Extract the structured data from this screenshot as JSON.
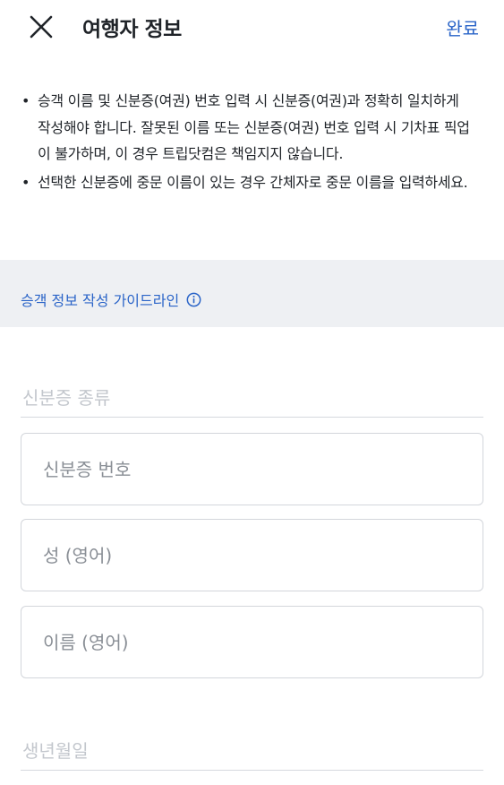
{
  "header": {
    "title": "여행자 정보",
    "done_label": "완료"
  },
  "notice": {
    "items": [
      {
        "text": "승객 이름 및 신분증(여권) 번호 입력 시 신분증(여권)과 정확히 일치하게 작성해야 합니다. 잘못된 이름 또는 신분증(여권) 번호 입력 시 기차표 픽업이 불가하며, 이 경우 트립닷컴은 책임지지 않습니다."
      },
      {
        "text": "선택한 신분증에 중문 이름이 있는 경우 간체자로 중문 이름을 입력하세요."
      }
    ],
    "bullet": "•"
  },
  "guide": {
    "link_label": "승객 정보 작성 가이드라인"
  },
  "form": {
    "id_type_label": "신분증 종류",
    "id_number_placeholder": "신분증 번호",
    "last_name_placeholder": "성 (영어)",
    "first_name_placeholder": "이름 (영어)",
    "birthdate_label": "생년월일"
  },
  "colors": {
    "accent": "#2a64c8",
    "band": "#eef0f3",
    "placeholder": "#8a8f96",
    "muted_label": "#c3c7cd"
  }
}
